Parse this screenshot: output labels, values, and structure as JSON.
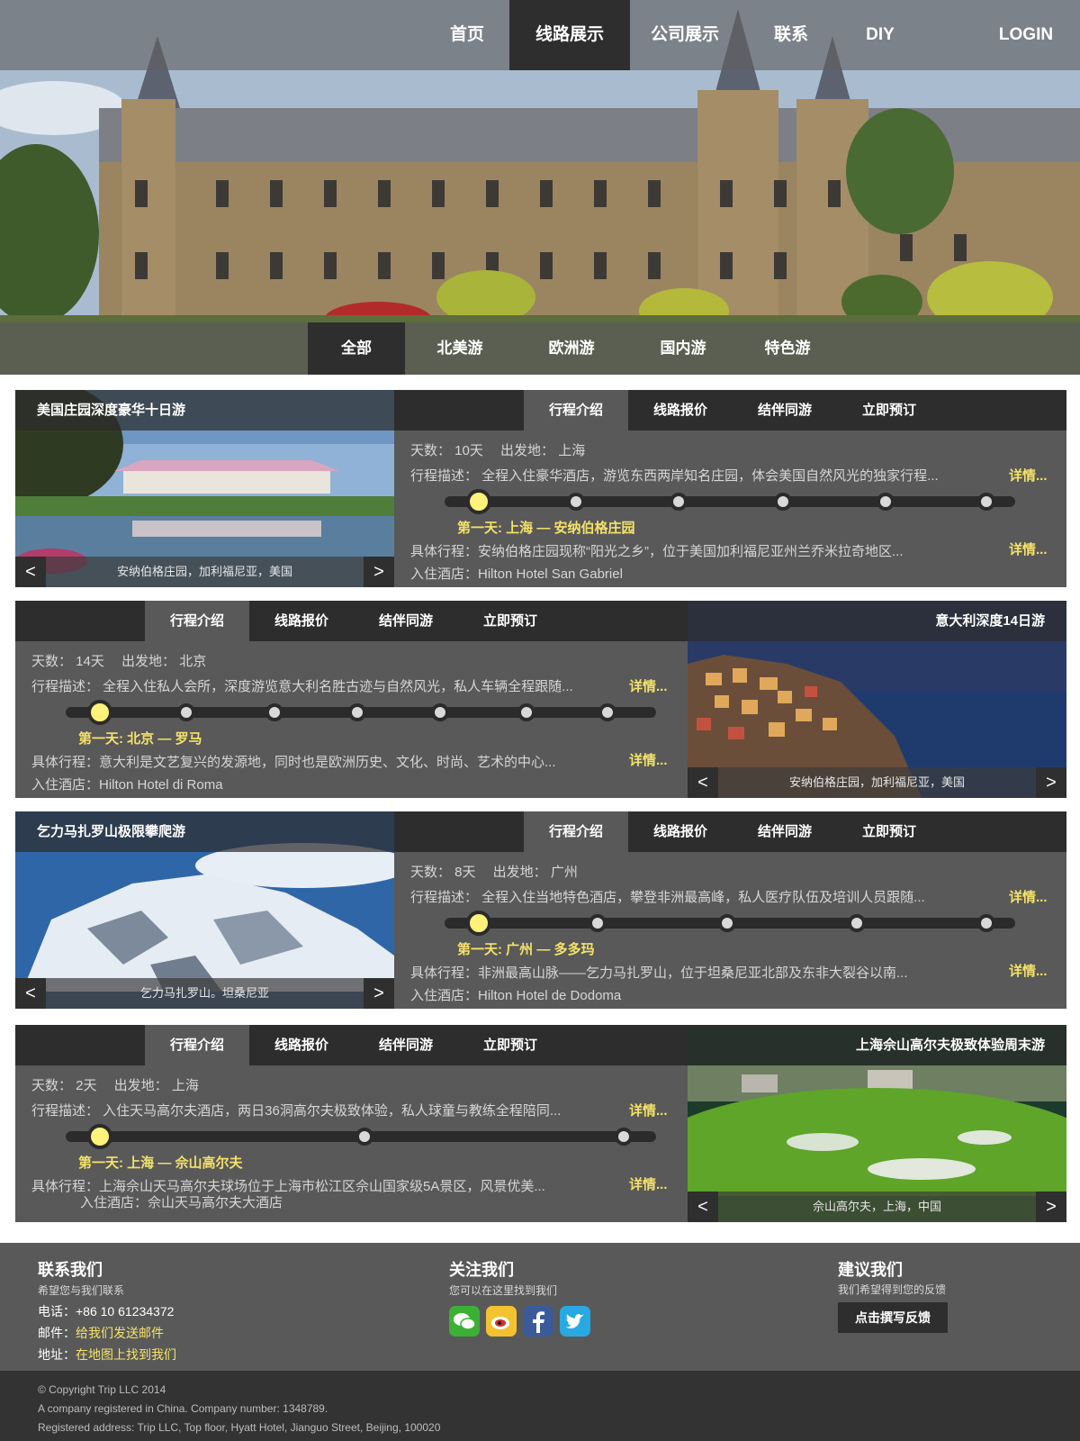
{
  "nav": {
    "items": [
      "首页",
      "线路展示",
      "公司展示",
      "联系",
      "DIY"
    ],
    "active": "线路展示",
    "login": "LOGIN"
  },
  "categories": {
    "items": [
      "全部",
      "北美游",
      "欧洲游",
      "国内游",
      "特色游"
    ],
    "active": "全部"
  },
  "tabs_labels": [
    "行程介绍",
    "线路报价",
    "结伴同游",
    "立即预订"
  ],
  "routes": [
    {
      "title": "美国庄园深度豪华十日游",
      "caption": "安纳伯格庄园，加利福尼亚，美国",
      "days": "天数： 10天　 出发地： 上海",
      "desc": "行程描述： 全程入住豪华酒店，游览东西两岸知名庄园，体会美国自然风光的独家行程...",
      "more": "详情...",
      "day_label": "第一天: 上海 — 安纳伯格庄园",
      "detail": "具体行程：安纳伯格庄园现称“阳光之乡”，位于美国加利福尼亚州兰乔米拉奇地区...",
      "hotel": "入住酒店：Hilton Hotel San Gabriel",
      "stops": 6
    },
    {
      "title": "意大利深度14日游",
      "caption": "安纳伯格庄园，加利福尼亚，美国",
      "days": "天数： 14天　 出发地： 北京",
      "desc": "行程描述： 全程入住私人会所，深度游览意大利名胜古迹与自然风光，私人车辆全程跟随...",
      "more": "详情...",
      "day_label": "第一天: 北京 — 罗马",
      "detail": "具体行程：意大利是文艺复兴的发源地，同时也是欧洲历史、文化、时尚、艺术的中心...",
      "hotel": "入住酒店：Hilton Hotel di Roma",
      "stops": 7
    },
    {
      "title": "乞力马扎罗山极限攀爬游",
      "caption": "乞力马扎罗山。坦桑尼亚",
      "days": "天数： 8天　 出发地： 广州",
      "desc": "行程描述： 全程入住当地特色酒店，攀登非洲最高峰，私人医疗队伍及培训人员跟随...",
      "more": "详情...",
      "day_label": "第一天: 广州 — 多多玛",
      "detail": "具体行程：非洲最高山脉——乞力马扎罗山，位于坦桑尼亚北部及东非大裂谷以南...",
      "hotel": "入住酒店：Hilton Hotel de Dodoma",
      "stops": 5
    },
    {
      "title": "上海佘山高尔夫极致体验周末游",
      "caption": "佘山高尔夫，上海，中国",
      "days": "天数： 2天　 出发地： 上海",
      "desc": "行程描述： 入住天马高尔夫酒店，两日36洞高尔夫极致体验，私人球童与教练全程陪同...",
      "more": "详情...",
      "day_label": "第一天: 上海 — 佘山高尔夫",
      "detail": "具体行程：上海佘山天马高尔夫球场位于上海市松江区佘山国家级5A景区，风景优美...",
      "hotel": "入住酒店：佘山天马高尔夫大酒店",
      "stops": 3
    }
  ],
  "footer": {
    "contact": {
      "title": "联系我们",
      "sub": "希望您与我们联系",
      "phone": "电话：+86 10 61234372",
      "mail_label": "邮件：",
      "mail_link": "给我们发送邮件",
      "addr_label": "地址：",
      "addr_link": "在地图上找到我们"
    },
    "follow": {
      "title": "关注我们",
      "sub": "您可以在这里找到我们",
      "icons": [
        "wechat-icon",
        "weibo-icon",
        "facebook-icon",
        "twitter-icon"
      ]
    },
    "suggest": {
      "title": "建议我们",
      "sub": "我们希望得到您的反馈",
      "button": "点击撰写反馈"
    }
  },
  "copyright": {
    "line1": "© Copyright Trip LLC 2014",
    "line2": "A company registered in China. Company number: 1348789.",
    "line3": "Registered address: Trip LLC, Top floor, Hyatt Hotel, Jianguo Street, Beijing, 100020"
  },
  "colors": {
    "accent_yellow": "#f4e26a",
    "dark": "#2d2d2d",
    "panel": "#595959"
  }
}
